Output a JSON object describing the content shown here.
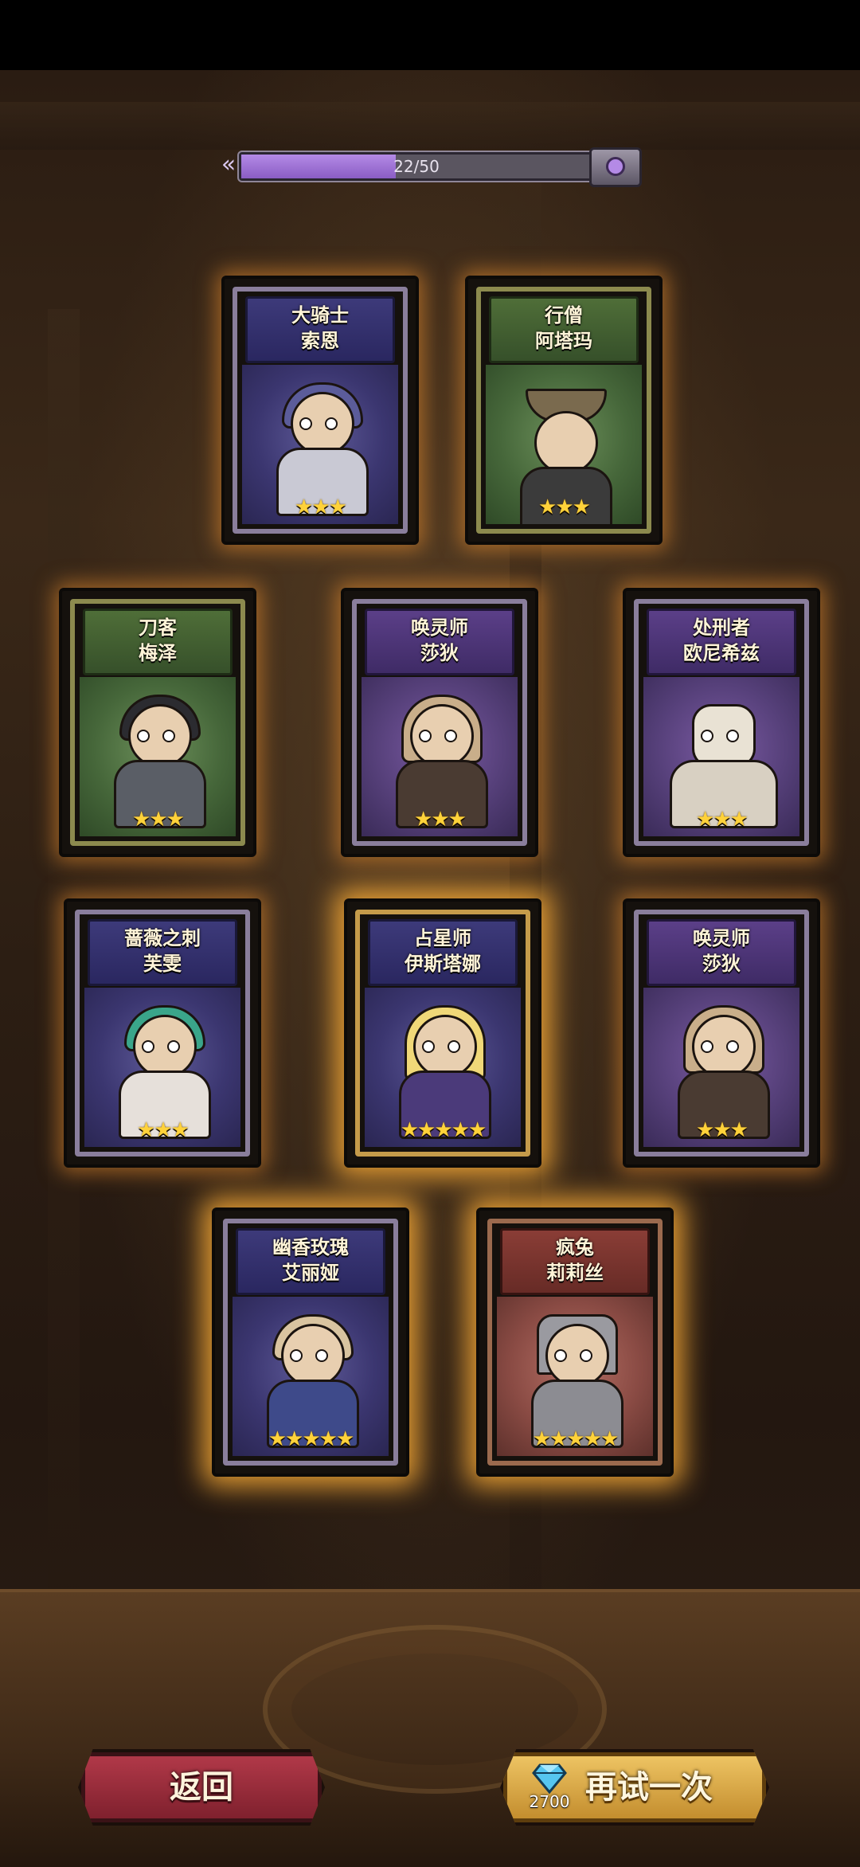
{
  "progress": {
    "label": "22/50",
    "value": 22,
    "max": 50
  },
  "cards": [
    {
      "title": "大骑士",
      "name": "索恩",
      "stars": 3,
      "theme": "blue"
    },
    {
      "title": "行僧",
      "name": "阿塔玛",
      "stars": 3,
      "theme": "green"
    },
    {
      "title": "刀客",
      "name": "梅泽",
      "stars": 3,
      "theme": "green"
    },
    {
      "title": "唤灵师",
      "name": "莎狄",
      "stars": 3,
      "theme": "purple"
    },
    {
      "title": "处刑者",
      "name": "欧尼希兹",
      "stars": 3,
      "theme": "purple"
    },
    {
      "title": "蔷薇之刺",
      "name": "芙雯",
      "stars": 3,
      "theme": "blue"
    },
    {
      "title": "占星师",
      "name": "伊斯塔娜",
      "stars": 5,
      "theme": "blue"
    },
    {
      "title": "唤灵师",
      "name": "莎狄",
      "stars": 3,
      "theme": "purple"
    },
    {
      "title": "幽香玫瑰",
      "name": "艾丽娅",
      "stars": 5,
      "theme": "blue"
    },
    {
      "title": "疯兔",
      "name": "莉莉丝",
      "stars": 5,
      "theme": "red"
    }
  ],
  "star_strings": [
    "★★★",
    "★★★★★"
  ],
  "buttons": {
    "back_label": "返回",
    "retry_label": "再试一次",
    "retry_cost": "2700"
  },
  "colors": {
    "accent_gold": "#ffd23a",
    "progress_fill": "#a77ad8",
    "back_red": "#9c2c3a",
    "retry_gold": "#e2b04f"
  },
  "icons": {
    "progress_arrow": "double-chevron-left-icon",
    "chest": "treasure-chest-icon",
    "cost": "diamond-icon"
  }
}
